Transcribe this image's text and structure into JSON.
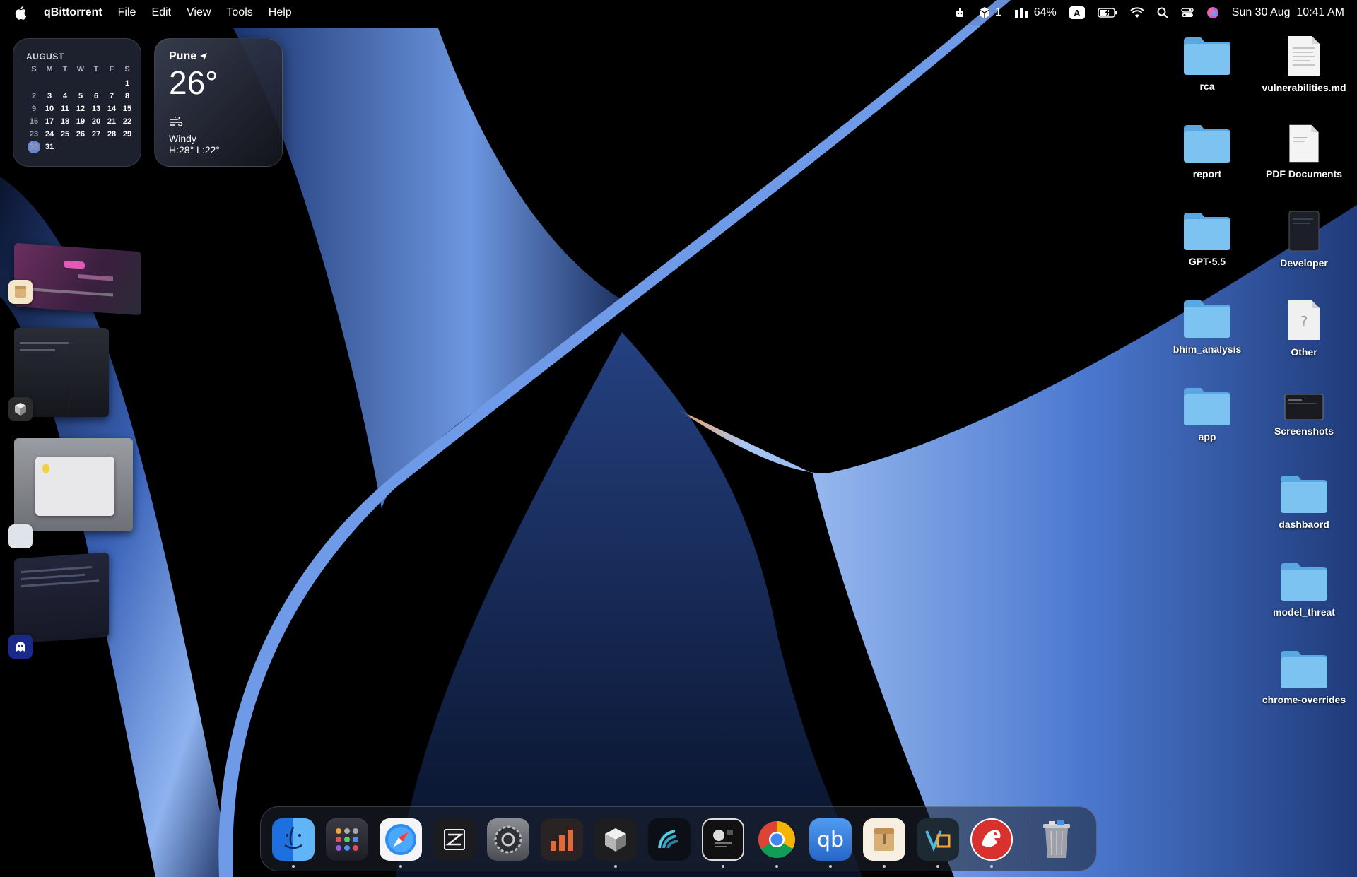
{
  "menubar": {
    "app_name": "qBittorrent",
    "menus": [
      "File",
      "Edit",
      "View",
      "Tools",
      "Help"
    ],
    "status_count": "1",
    "battery": "64%",
    "input_source": "A",
    "datetime": "Sun 30 Aug  10:41 AM"
  },
  "calendar": {
    "month": "AUGUST",
    "weekdays": [
      "S",
      "M",
      "T",
      "W",
      "T",
      "F",
      "S"
    ],
    "days": [
      "",
      "",
      "",
      "",
      "",
      "",
      "1",
      "2",
      "3",
      "4",
      "5",
      "6",
      "7",
      "8",
      "9",
      "10",
      "11",
      "12",
      "13",
      "14",
      "15",
      "16",
      "17",
      "18",
      "19",
      "20",
      "21",
      "22",
      "23",
      "24",
      "25",
      "26",
      "27",
      "28",
      "29",
      "30",
      "31",
      "",
      "",
      "",
      "",
      ""
    ],
    "today": "30"
  },
  "weather": {
    "city": "Pune",
    "temp": "26°",
    "condition": "Windy",
    "high_low": "H:28° L:22°"
  },
  "desktop": {
    "left_column": [
      {
        "label": "rca",
        "kind": "folder"
      },
      {
        "label": "report",
        "kind": "folder"
      },
      {
        "label": "GPT-5.5",
        "kind": "folder"
      },
      {
        "label": "bhim_analysis",
        "kind": "folder"
      },
      {
        "label": "app",
        "kind": "folder"
      }
    ],
    "right_column": [
      {
        "label": "vulnerabilities.md",
        "kind": "document"
      },
      {
        "label": "PDF Documents",
        "kind": "document"
      },
      {
        "label": "Developer",
        "kind": "dark-doc"
      },
      {
        "label": "Other",
        "kind": "unknown-doc"
      },
      {
        "label": "Screenshots",
        "kind": "screenshot"
      },
      {
        "label": "dashbaord",
        "kind": "folder"
      },
      {
        "label": "model_threat",
        "kind": "folder"
      },
      {
        "label": "chrome-overrides",
        "kind": "folder"
      }
    ]
  },
  "dock": {
    "apps": [
      {
        "name": "finder-icon",
        "running": true
      },
      {
        "name": "launchpad-icon",
        "running": false
      },
      {
        "name": "safari-icon",
        "running": true
      },
      {
        "name": "zed-icon",
        "running": false
      },
      {
        "name": "system-settings-icon",
        "running": false
      },
      {
        "name": "chart-app-icon",
        "running": false
      },
      {
        "name": "cube-app-icon",
        "running": true
      },
      {
        "name": "wave-app-icon",
        "running": false
      },
      {
        "name": "terminal-app-icon",
        "running": true
      },
      {
        "name": "chrome-icon",
        "running": true
      },
      {
        "name": "qbittorrent-icon",
        "running": true
      },
      {
        "name": "archive-utility-icon",
        "running": true
      },
      {
        "name": "vmware-icon",
        "running": true
      },
      {
        "name": "red-dragon-icon",
        "running": true
      }
    ],
    "trash": "trash-icon"
  },
  "colors": {
    "folder": "#6fb8ec",
    "accent": "#6d86c9"
  }
}
